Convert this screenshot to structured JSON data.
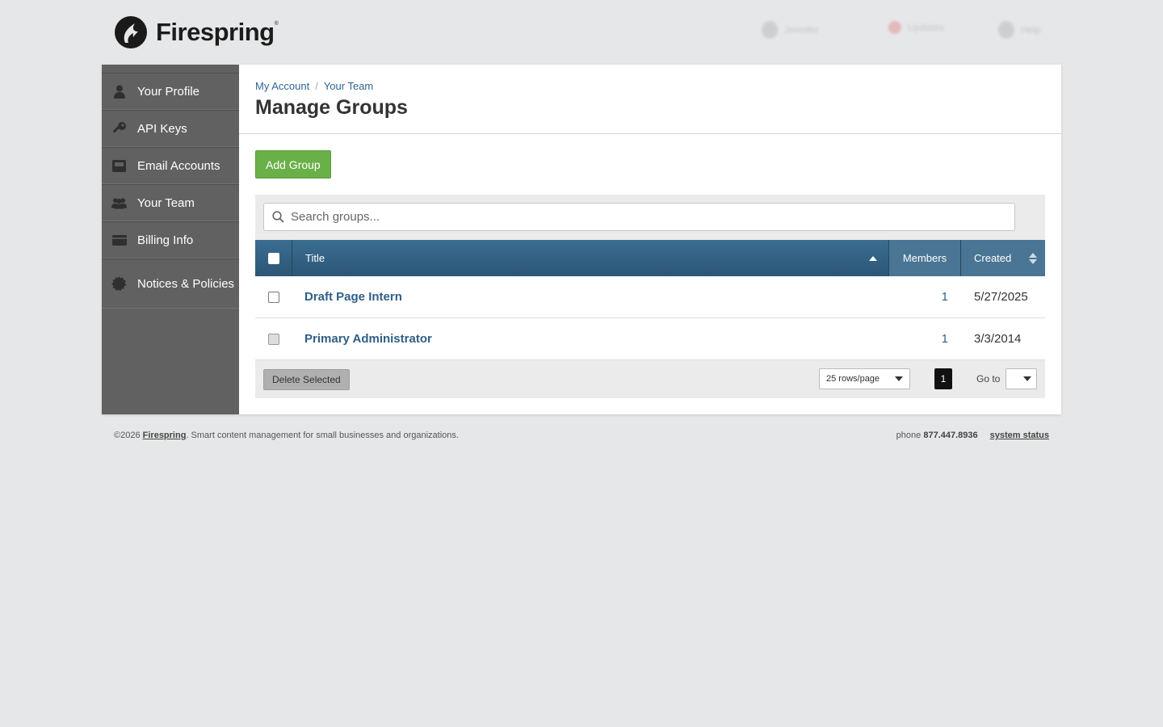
{
  "header": {
    "brand": "Firespring",
    "brand_mark": "®",
    "top_actions": [
      {
        "label": "Jennifer",
        "icon": "user-icon"
      },
      {
        "label": "Updates",
        "icon": "notification-icon"
      },
      {
        "label": "Help",
        "icon": "help-icon"
      }
    ]
  },
  "sidebar": {
    "items": [
      {
        "label": "Your Profile",
        "icon": "user-icon"
      },
      {
        "label": "API Keys",
        "icon": "key-icon"
      },
      {
        "label": "Email Accounts",
        "icon": "inbox-icon"
      },
      {
        "label": "Your Team",
        "icon": "team-icon"
      },
      {
        "label": "Billing Info",
        "icon": "credit-card-icon"
      },
      {
        "label": "Notices & Policies",
        "icon": "seal-icon"
      }
    ]
  },
  "breadcrumb": {
    "items": [
      "My Account",
      "Your Team"
    ],
    "separator": "/"
  },
  "page": {
    "title": "Manage Groups",
    "add_button": "Add Group"
  },
  "search": {
    "placeholder": "Search groups..."
  },
  "table": {
    "headers": {
      "title": "Title",
      "members": "Members",
      "created": "Created"
    },
    "rows": [
      {
        "title": "Draft Page Intern",
        "members": "1",
        "created": "5/27/2025",
        "checkbox_disabled": false
      },
      {
        "title": "Primary Administrator",
        "members": "1",
        "created": "3/3/2014",
        "checkbox_disabled": true
      }
    ]
  },
  "table_footer": {
    "delete_button": "Delete Selected",
    "rows_per_page": "25 rows/page",
    "current_page": "1",
    "goto_label": "Go to"
  },
  "footer": {
    "copyright": "©2026",
    "brand": "Firespring",
    "tagline": ". Smart content management for small businesses and organizations.",
    "phone_label": "phone",
    "phone": "877.447.8936",
    "status_link": "system status"
  },
  "colors": {
    "sidebar_bg": "#616161",
    "header_blue": "#2f5f86",
    "add_green": "#6ab048",
    "page_bg": "#e6e7e8"
  }
}
